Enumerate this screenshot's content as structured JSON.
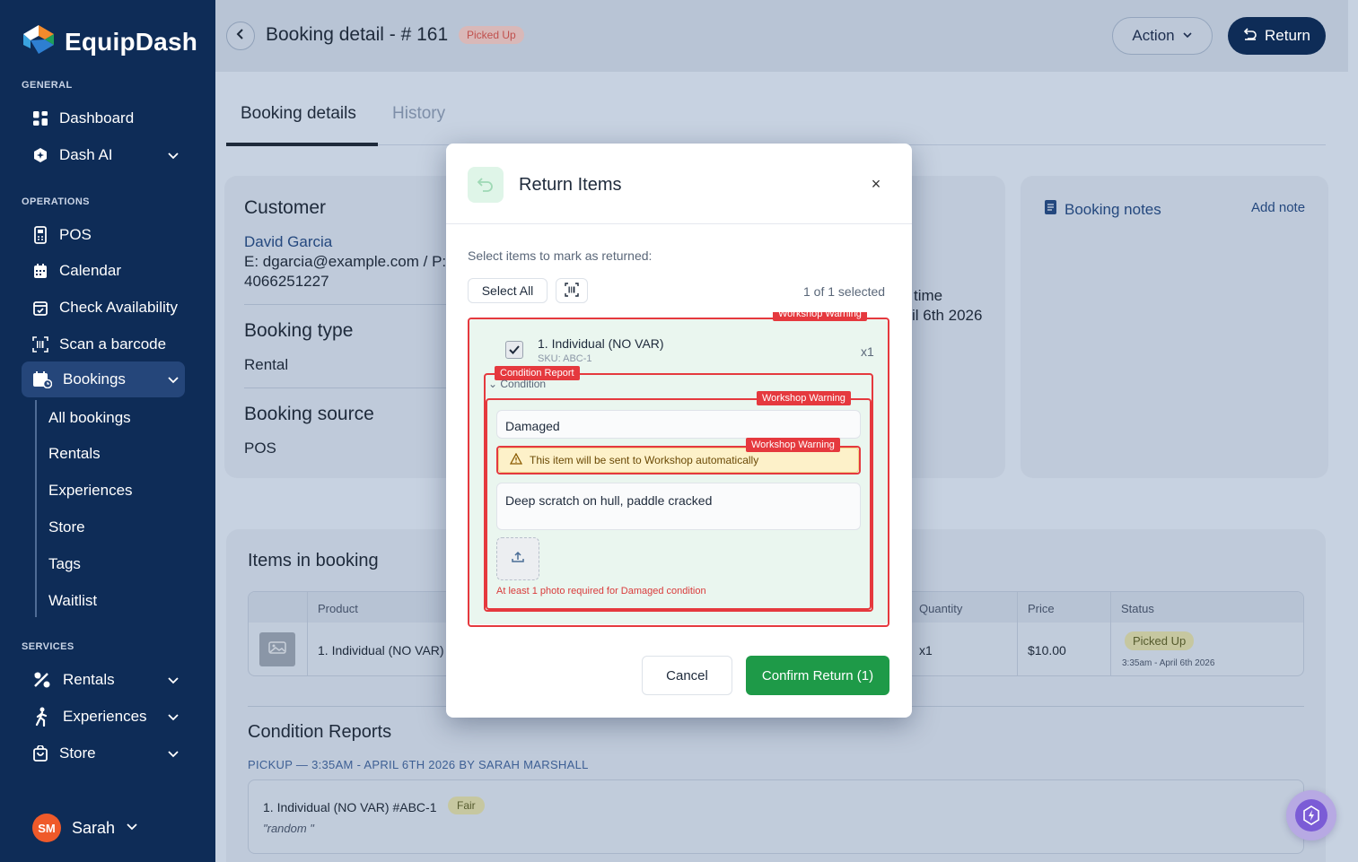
{
  "sidebar": {
    "brand": "EquipDash",
    "sections": {
      "general": "GENERAL",
      "operations": "OPERATIONS",
      "services": "SERVICES"
    },
    "items": {
      "dashboard": "Dashboard",
      "dash_ai": "Dash AI",
      "pos": "POS",
      "calendar": "Calendar",
      "check_availability": "Check Availability",
      "scan_barcode": "Scan a barcode",
      "bookings": "Bookings",
      "rentals": "Rentals",
      "experiences": "Experiences",
      "store": "Store"
    },
    "bookings_sub": [
      "All bookings",
      "Rentals",
      "Experiences",
      "Store",
      "Tags",
      "Waitlist"
    ],
    "user": {
      "initials": "SM",
      "name": "Sarah"
    }
  },
  "header": {
    "title": "Booking detail - # 161",
    "status": "Picked Up",
    "action_label": "Action",
    "return_label": "Return"
  },
  "tabs": [
    "Booking details",
    "History"
  ],
  "details": {
    "customer_heading": "Customer",
    "customer_name": "David Garcia",
    "customer_contact": "E: dgarcia@example.com / P:",
    "customer_phone": "4066251227",
    "booking_type_heading": "Booking type",
    "booking_type": "Rental",
    "booking_source_heading": "Booking source",
    "booking_source": "POS",
    "return_time_label": "time",
    "return_time_value": "il 6th 2026",
    "notes_heading": "Booking notes",
    "add_note": "Add note"
  },
  "items_section": {
    "heading": "Items in booking",
    "columns": [
      "Product",
      "Quantity",
      "Price",
      "Status"
    ],
    "rows": [
      {
        "product": "1. Individual (NO VAR)",
        "quantity": "x1",
        "price": "$10.00",
        "status": "Picked Up",
        "status_time": "3:35am - April 6th 2026"
      }
    ]
  },
  "condition_reports": {
    "heading": "Condition Reports",
    "pickup_label": "PICKUP — 3:35AM - APRIL 6TH 2026 BY SARAH MARSHALL",
    "entry_item": "1. Individual (NO VAR) #ABC-1",
    "entry_condition": "Fair",
    "entry_note": "\"random \""
  },
  "modal": {
    "title": "Return Items",
    "subtitle": "Select items to mark as returned:",
    "select_all": "Select All",
    "selected_count": "1 of 1 selected",
    "item": {
      "name": "1. Individual (NO VAR)",
      "sku": "SKU: ABC-1",
      "qty": "x1",
      "checked": true
    },
    "condition_label": "Condition",
    "condition_value": "Damaged",
    "warning_text": "This item will be sent to Workshop automatically",
    "notes_value": "Deep scratch on hull, paddle cracked",
    "photo_error": "At least 1 photo required for Damaged condition",
    "cancel_label": "Cancel",
    "confirm_label": "Confirm Return (1)",
    "annotations": {
      "workshop_warning": "Workshop Warning",
      "condition_report": "Condition Report"
    }
  },
  "colors": {
    "sidebar_bg": "#0e2c57",
    "confirm_green": "#1e9a48",
    "warning_red": "#e5393e",
    "accent_navy": "#0e2c57"
  },
  "icons": [
    "logo-icon",
    "dashboard-icon",
    "ai-icon",
    "pos-icon",
    "calendar-icon",
    "check-availability-icon",
    "barcode-icon",
    "bookings-icon",
    "rentals-icon",
    "experiences-icon",
    "store-icon",
    "chevron-down-icon",
    "back-icon",
    "return-icon",
    "notes-icon",
    "close-icon",
    "upload-icon",
    "warning-icon",
    "lightning-icon"
  ]
}
